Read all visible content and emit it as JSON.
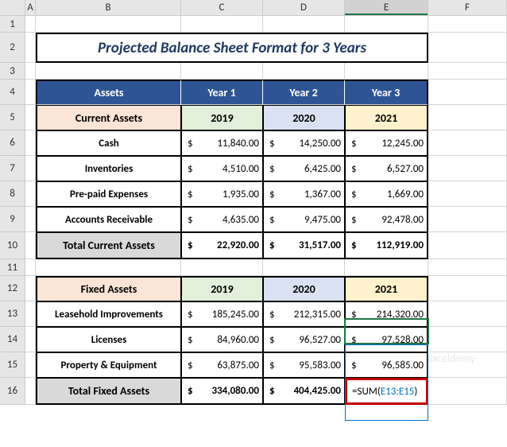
{
  "columns": [
    "A",
    "B",
    "C",
    "D",
    "E",
    "F"
  ],
  "rows": [
    "1",
    "2",
    "3",
    "4",
    "5",
    "6",
    "7",
    "8",
    "9",
    "10",
    "11",
    "12",
    "13",
    "14",
    "15",
    "16"
  ],
  "title": "Projected Balance Sheet Format for 3 Years",
  "table1": {
    "h1": "Assets",
    "h2": "Year 1",
    "h3": "Year 2",
    "h4": "Year 3",
    "sh1": "Current Assets",
    "sh2": "2019",
    "sh3": "2020",
    "sh4": "2021",
    "r1": {
      "l": "Cash",
      "c": "11,840.00",
      "d": "14,250.00",
      "e": "12,245.00"
    },
    "r2": {
      "l": "Inventories",
      "c": "4,510.00",
      "d": "6,425.00",
      "e": "6,527.00"
    },
    "r3": {
      "l": "Pre-paid Expenses",
      "c": "1,935.00",
      "d": "1,367.00",
      "e": "1,669.00"
    },
    "r4": {
      "l": "Accounts Receivable",
      "c": "4,635.00",
      "d": "9,475.00",
      "e": "92,478.00"
    },
    "t": {
      "l": "Total Current Assets",
      "c": "22,920.00",
      "d": "31,517.00",
      "e": "112,919.00"
    }
  },
  "table2": {
    "sh1": "Fixed Assets",
    "sh2": "2019",
    "sh3": "2020",
    "sh4": "2021",
    "r1": {
      "l": "Leasehold Improvements",
      "c": "185,245.00",
      "d": "212,315.00",
      "e": "214,320.00"
    },
    "r2": {
      "l": "Licenses",
      "c": "84,960.00",
      "d": "96,527.00",
      "e": "97,528.00"
    },
    "r3": {
      "l": "Property & Equipment",
      "c": "63,875.00",
      "d": "95,583.00",
      "e": "96,585.00"
    },
    "t": {
      "l": "Total Fixed Assets",
      "c": "334,080.00",
      "d": "404,425.00"
    }
  },
  "formula": {
    "pre": "=SUM(",
    "ref": "E13:E15",
    "post": ")"
  },
  "dollar": "$",
  "watermark": "exceldemy"
}
